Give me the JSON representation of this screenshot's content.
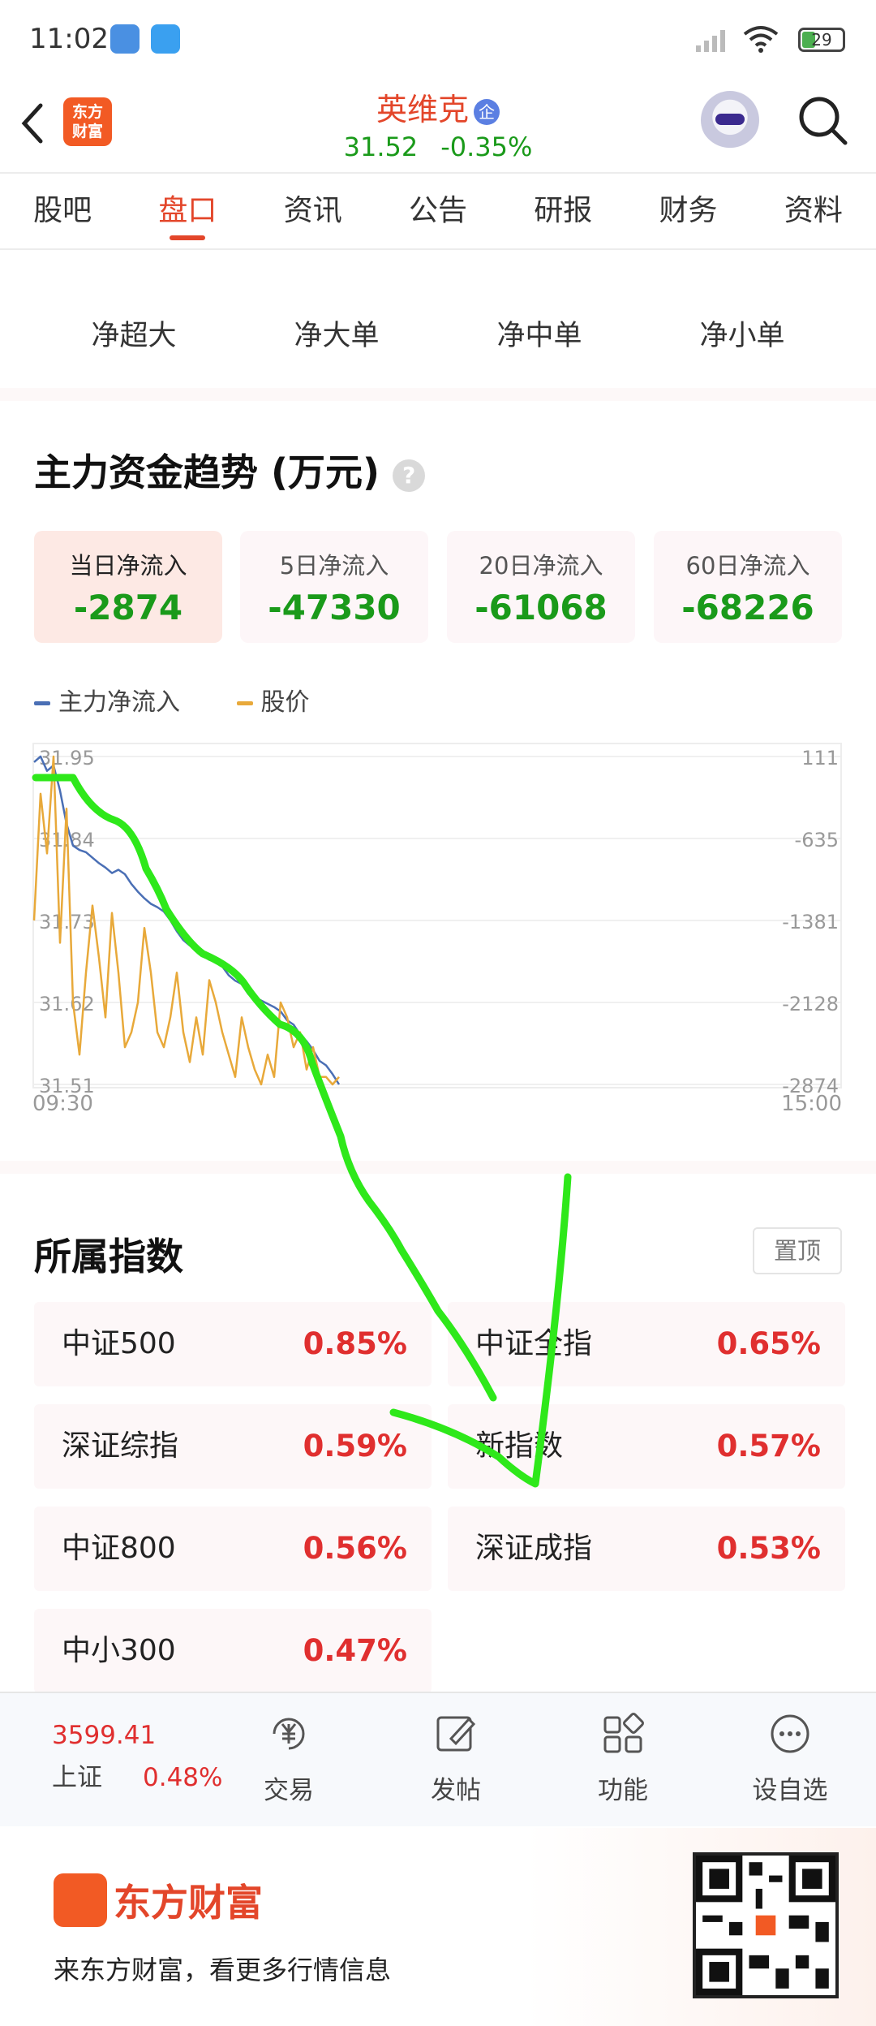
{
  "status": {
    "time": "11:02",
    "battery": "29"
  },
  "header": {
    "stock_name": "英维克",
    "badge": "企",
    "price": "31.52",
    "change": "-0.35%",
    "logo_text": "东方财富"
  },
  "tabs": [
    {
      "label": "股吧"
    },
    {
      "label": "盘口",
      "active": true
    },
    {
      "label": "资讯"
    },
    {
      "label": "公告"
    },
    {
      "label": "研报"
    },
    {
      "label": "财务"
    },
    {
      "label": "资料"
    }
  ],
  "subtabs": [
    {
      "label": "净超大"
    },
    {
      "label": "净大单"
    },
    {
      "label": "净中单"
    },
    {
      "label": "净小单"
    }
  ],
  "trend": {
    "title": "主力资金趋势 (万元)",
    "help": "?",
    "boxes": [
      {
        "label": "当日净流入",
        "value": "-2874",
        "active": true
      },
      {
        "label": "5日净流入",
        "value": "-47330"
      },
      {
        "label": "20日净流入",
        "value": "-61068"
      },
      {
        "label": "60日净流入",
        "value": "-68226"
      }
    ],
    "legend": [
      {
        "name": "主力净流入",
        "color": "#4a6fb5"
      },
      {
        "name": "股价",
        "color": "#e8a93a"
      }
    ]
  },
  "chart_data": {
    "type": "line",
    "title": "",
    "xlabel": "",
    "ylabel": "",
    "x_tick_labels": [
      "09:30",
      "15:00"
    ],
    "left_axis": {
      "label": "股价",
      "ylim": [
        31.51,
        31.95
      ],
      "ticks": [
        "31.95",
        "31.84",
        "31.73",
        "31.62",
        "31.51"
      ]
    },
    "right_axis": {
      "label": "主力净流入",
      "ylim": [
        -2874,
        111
      ],
      "ticks": [
        "111",
        "-635",
        "-1381",
        "-2128",
        "-2874"
      ]
    },
    "grid": true,
    "series": [
      {
        "name": "主力净流入",
        "color": "#4a6fb5",
        "axis": "right",
        "values": [
          60,
          111,
          -20,
          30,
          -200,
          -500,
          -700,
          -740,
          -760,
          -810,
          -860,
          -900,
          -950,
          -920,
          -960,
          -1050,
          -1120,
          -1180,
          -1230,
          -1260,
          -1300,
          -1380,
          -1480,
          -1560,
          -1610,
          -1640,
          -1700,
          -1740,
          -1760,
          -1800,
          -1880,
          -1930,
          -1960,
          -2050,
          -2080,
          -2110,
          -2140,
          -2170,
          -2210,
          -2290,
          -2330,
          -2420,
          -2480,
          -2560,
          -2660,
          -2700,
          -2780,
          -2874
        ]
      },
      {
        "name": "股价",
        "color": "#e8a93a",
        "axis": "left",
        "values": [
          31.73,
          31.9,
          31.82,
          31.95,
          31.7,
          31.88,
          31.62,
          31.55,
          31.66,
          31.75,
          31.68,
          31.6,
          31.74,
          31.66,
          31.56,
          31.58,
          31.62,
          31.72,
          31.66,
          31.58,
          31.56,
          31.6,
          31.66,
          31.58,
          31.54,
          31.6,
          31.55,
          31.65,
          31.62,
          31.58,
          31.55,
          31.52,
          31.6,
          31.56,
          31.53,
          31.51,
          31.55,
          31.52,
          31.62,
          31.6,
          31.56,
          31.58,
          31.53,
          31.56,
          31.52,
          31.52,
          31.51,
          31.52
        ]
      }
    ]
  },
  "index_section": {
    "title": "所属指数",
    "pin_label": "置顶",
    "items": [
      {
        "name": "中证500",
        "pct": "0.85%"
      },
      {
        "name": "中证全指",
        "pct": "0.65%"
      },
      {
        "name": "深证综指",
        "pct": "0.59%"
      },
      {
        "name": "新指数",
        "pct": "0.57%"
      },
      {
        "name": "中证800",
        "pct": "0.56%"
      },
      {
        "name": "深证成指",
        "pct": "0.53%"
      },
      {
        "name": "中小300",
        "pct": "0.47%"
      }
    ]
  },
  "bottom_bar": {
    "index_value": "3599.41",
    "index_name": "上证",
    "index_pct": "0.48%",
    "items": [
      {
        "label": "交易",
        "icon": "yen-cycle-icon"
      },
      {
        "label": "发帖",
        "icon": "edit-icon"
      },
      {
        "label": "功能",
        "icon": "grid-icon"
      },
      {
        "label": "设自选",
        "icon": "more-icon"
      }
    ]
  },
  "ad": {
    "brand": "东方财富",
    "text": "来东方财富，看更多行情信息"
  },
  "annotation": {
    "stroke_color": "#2ee81a"
  }
}
